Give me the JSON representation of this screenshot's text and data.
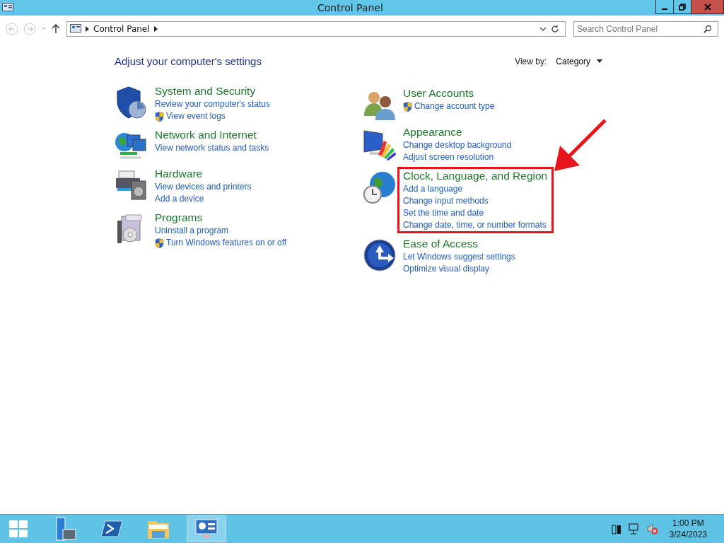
{
  "window": {
    "title": "Control Panel"
  },
  "address_bar": {
    "path": "Control Panel"
  },
  "search": {
    "placeholder": "Search Control Panel"
  },
  "heading": "Adjust your computer's settings",
  "view_by": {
    "label": "View by:",
    "value": "Category"
  },
  "columns": [
    [
      {
        "kind": "security",
        "title": "System and Security",
        "highlighted": false,
        "links": [
          {
            "text": "Review your computer's status",
            "shield": false
          },
          {
            "text": "View event logs",
            "shield": true
          }
        ]
      },
      {
        "kind": "network",
        "title": "Network and Internet",
        "highlighted": false,
        "links": [
          {
            "text": "View network status and tasks",
            "shield": false
          }
        ]
      },
      {
        "kind": "hardware",
        "title": "Hardware",
        "highlighted": false,
        "links": [
          {
            "text": "View devices and printers",
            "shield": false
          },
          {
            "text": "Add a device",
            "shield": false
          }
        ]
      },
      {
        "kind": "programs",
        "title": "Programs",
        "highlighted": false,
        "links": [
          {
            "text": "Uninstall a program",
            "shield": false
          },
          {
            "text": "Turn Windows features on or off",
            "shield": true
          }
        ]
      }
    ],
    [
      {
        "kind": "users",
        "title": "User Accounts",
        "highlighted": false,
        "links": [
          {
            "text": "Change account type",
            "shield": true
          }
        ]
      },
      {
        "kind": "appearance",
        "title": "Appearance",
        "highlighted": false,
        "links": [
          {
            "text": "Change desktop background",
            "shield": false
          },
          {
            "text": "Adjust screen resolution",
            "shield": false
          }
        ]
      },
      {
        "kind": "clock",
        "title": "Clock, Language, and Region",
        "highlighted": true,
        "links": [
          {
            "text": "Add a language",
            "shield": false
          },
          {
            "text": "Change input methods",
            "shield": false
          },
          {
            "text": "Set the time and date",
            "shield": false
          },
          {
            "text": "Change date, time, or number formats",
            "shield": false
          }
        ]
      },
      {
        "kind": "ease",
        "title": "Ease of Access",
        "highlighted": false,
        "links": [
          {
            "text": "Let Windows suggest settings",
            "shield": false
          },
          {
            "text": "Optimize visual display",
            "shield": false
          }
        ]
      }
    ]
  ],
  "taskbar": {
    "apps": [
      {
        "kind": "server",
        "selected": false
      },
      {
        "kind": "powershell",
        "selected": false
      },
      {
        "kind": "explorer",
        "selected": false
      },
      {
        "kind": "control",
        "selected": true
      }
    ],
    "time": "1:00 PM",
    "date": "3/24/2023"
  }
}
